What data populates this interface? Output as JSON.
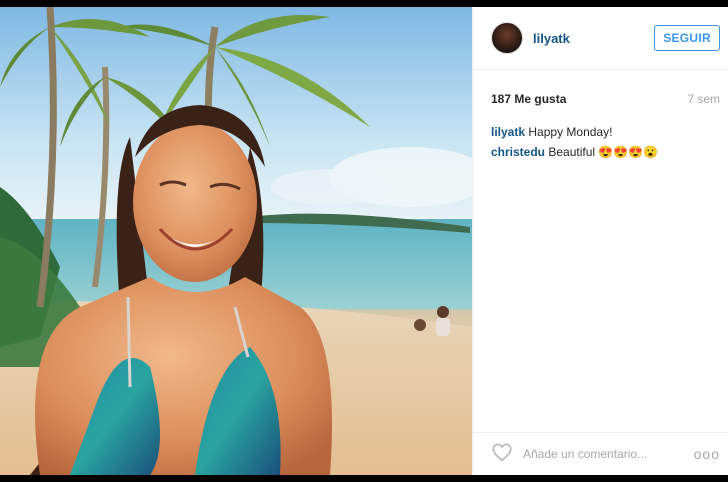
{
  "post": {
    "username": "lilyatk",
    "follow_label": "SEGUIR",
    "likes": "187 Me gusta",
    "time_ago": "7 sem",
    "comments": [
      {
        "user": "lilyatk",
        "text": "Happy Monday!"
      },
      {
        "user": "christedu",
        "text": "Beautiful 😍😍😍😮"
      }
    ],
    "add_comment_placeholder": "Añade un comentario...",
    "more_label": "ooo"
  },
  "colors": {
    "accent": "#3897f0",
    "username": "#125688",
    "muted": "#a5a7aa"
  },
  "icons": {
    "heart": "heart-icon",
    "more": "more-options-icon"
  }
}
